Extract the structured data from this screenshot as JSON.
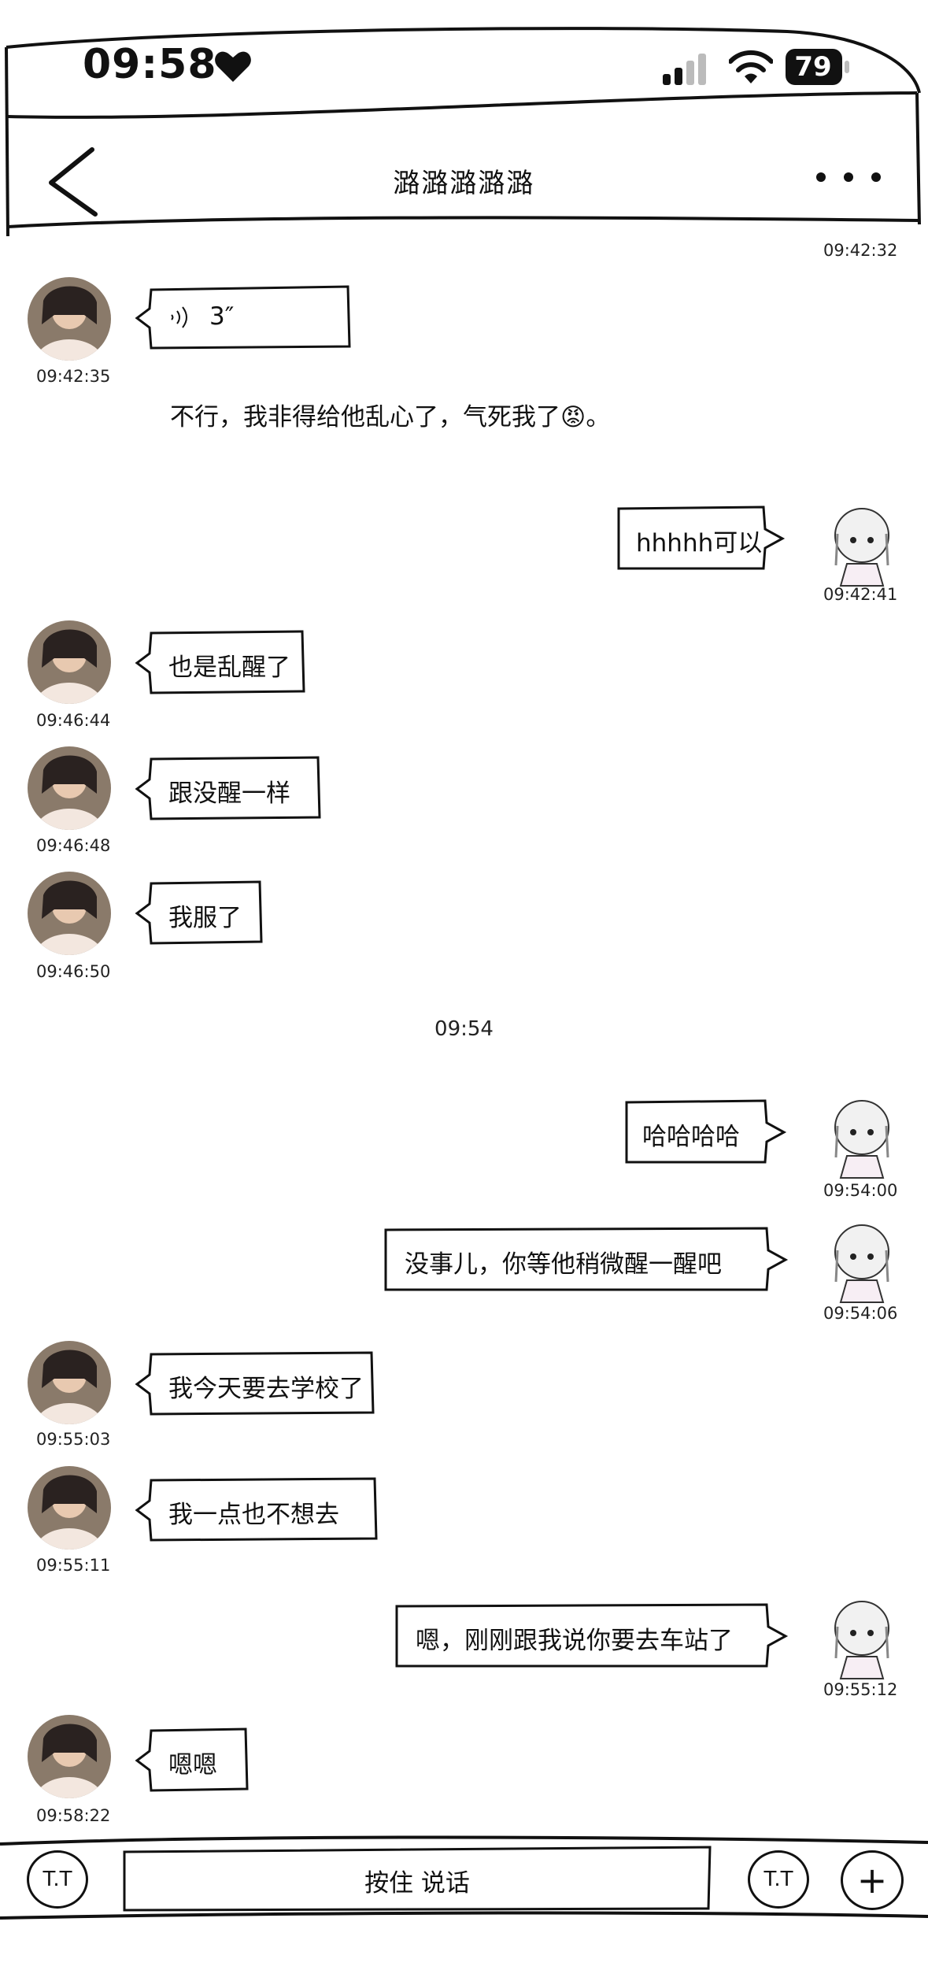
{
  "status_bar": {
    "time": "09:58",
    "battery": "79"
  },
  "header": {
    "title": "潞潞潞潞潞"
  },
  "messages": [
    {
      "type": "timestamp-partial",
      "time": "09:42:32"
    },
    {
      "side": "left",
      "kind": "voice",
      "voice_label": "3″",
      "time": "09:42:35",
      "transcript": "不行，我非得给他乱心了，气死我了😡。"
    },
    {
      "side": "right",
      "text": "hhhhh可以",
      "time": "09:42:41"
    },
    {
      "side": "left",
      "text": "也是乱醒了",
      "time": "09:46:44"
    },
    {
      "side": "left",
      "text": "跟没醒一样",
      "time": "09:46:48"
    },
    {
      "side": "left",
      "text": "我服了",
      "time": "09:46:50"
    },
    {
      "type": "divider",
      "time": "09:54"
    },
    {
      "side": "right",
      "text": "哈哈哈哈",
      "time": "09:54:00"
    },
    {
      "side": "right",
      "text": "没事儿，你等他稍微醒一醒吧",
      "time": "09:54:06"
    },
    {
      "side": "left",
      "text": "我今天要去学校了",
      "time": "09:55:03"
    },
    {
      "side": "left",
      "text": "我一点也不想去",
      "time": "09:55:11"
    },
    {
      "side": "right",
      "text": "嗯，刚刚跟我说你要去车站了",
      "time": "09:55:12"
    },
    {
      "side": "left",
      "text": "嗯嗯",
      "time": "09:58:22"
    }
  ],
  "input_bar": {
    "hold_to_talk": "按住 说话",
    "emoji_left": "T.T",
    "emoji_right": "T.T",
    "plus": "+"
  }
}
